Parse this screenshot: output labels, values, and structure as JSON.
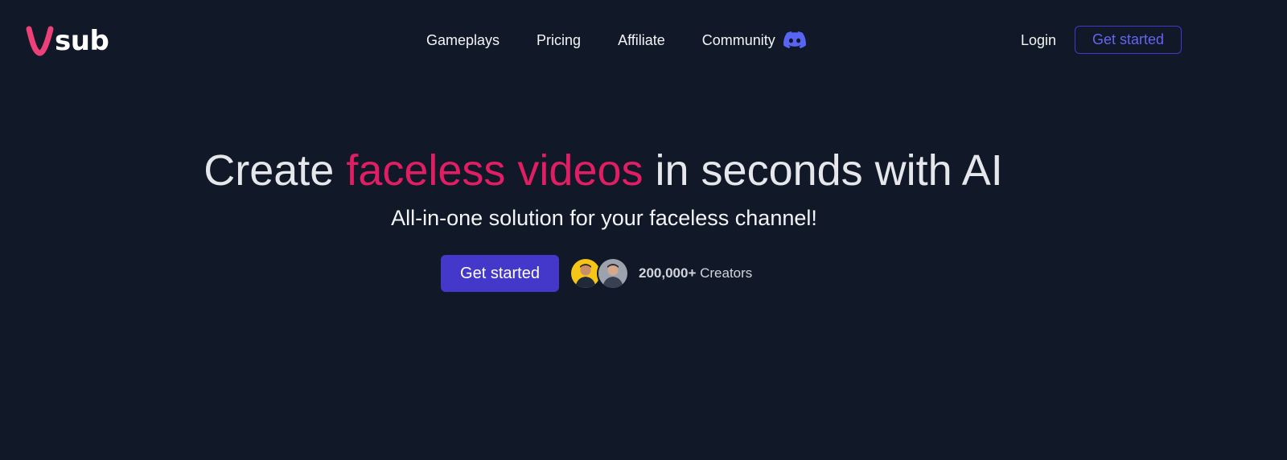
{
  "brand": {
    "name": "sub",
    "accent_color": "#ec4178",
    "logo_icon": "v-logo-icon"
  },
  "nav": {
    "items": [
      {
        "label": "Gameplays"
      },
      {
        "label": "Pricing"
      },
      {
        "label": "Affiliate"
      },
      {
        "label": "Community",
        "icon": "discord-icon"
      }
    ]
  },
  "header": {
    "login_label": "Login",
    "cta_label": "Get started",
    "cta_color": "#4338ca"
  },
  "hero": {
    "title_before": "Create ",
    "title_accent": "faceless videos",
    "title_after": " in seconds with AI",
    "title_accent_color": "#e11d63",
    "subtitle": "All-in-one solution for your faceless channel!",
    "cta_label": "Get started",
    "cta_color": "#4338ca",
    "creators_count": "200,000+",
    "creators_label": " Creators",
    "avatars": [
      "creator-avatar-1",
      "creator-avatar-2"
    ]
  },
  "colors": {
    "background": "#111827",
    "text": "#e5e7eb"
  }
}
